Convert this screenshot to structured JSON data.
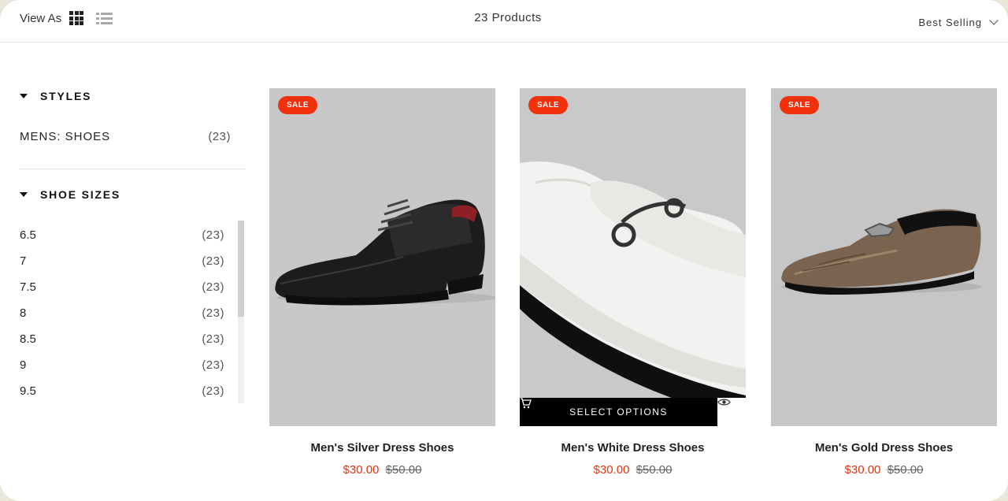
{
  "toolbar": {
    "view_as_label": "View As",
    "grid_view_icon": "grid-view-icon",
    "list_view_icon": "list-view-icon",
    "product_count": "23  Products",
    "sort_label": "Best Selling"
  },
  "sidebar": {
    "styles": {
      "title": "STYLES",
      "items": [
        {
          "label": "MENS: SHOES",
          "count": "(23)"
        }
      ]
    },
    "sizes": {
      "title": "SHOE SIZES",
      "items": [
        {
          "label": "6.5",
          "count": "(23)"
        },
        {
          "label": "7",
          "count": "(23)"
        },
        {
          "label": "7.5",
          "count": "(23)"
        },
        {
          "label": "8",
          "count": "(23)"
        },
        {
          "label": "8.5",
          "count": "(23)"
        },
        {
          "label": "9",
          "count": "(23)"
        },
        {
          "label": "9.5",
          "count": "(23)"
        }
      ]
    }
  },
  "products": [
    {
      "badge": "SALE",
      "title": "Men's Silver Dress Shoes",
      "price": "$30.00",
      "compare_price": "$50.00"
    },
    {
      "badge": "SALE",
      "title": "Men's White Dress Shoes",
      "price": "$30.00",
      "compare_price": "$50.00",
      "select_options_label": "SELECT OPTIONS"
    },
    {
      "badge": "SALE",
      "title": "Men's Gold Dress Shoes",
      "price": "$30.00",
      "compare_price": "$50.00"
    }
  ],
  "colors": {
    "sale_badge": "#f1300c",
    "price": "#e2330e",
    "select_bar": "#000000"
  }
}
